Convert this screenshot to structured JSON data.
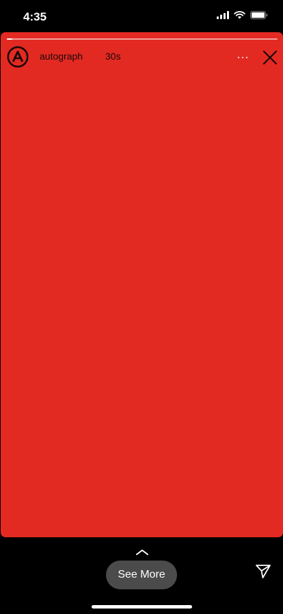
{
  "status_bar": {
    "time": "4:35",
    "icons": [
      "cellular-signal-icon",
      "wifi-icon",
      "battery-icon"
    ]
  },
  "story": {
    "background_color": "#e22a22",
    "progress": 0.02,
    "username": "autograph",
    "timestamp": "30s",
    "avatar_letter": "A"
  },
  "bottom": {
    "see_more_label": "See More",
    "icons": [
      "chevron-up-icon",
      "send-icon"
    ]
  }
}
